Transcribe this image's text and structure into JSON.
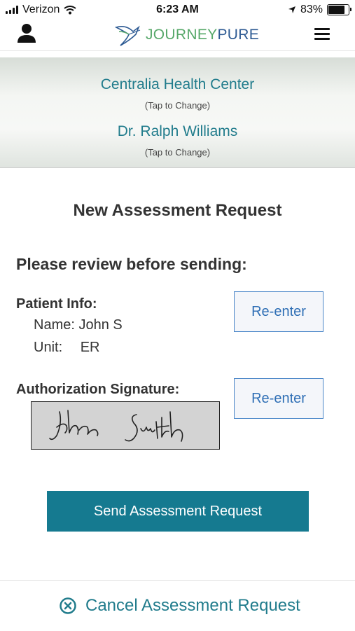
{
  "status_bar": {
    "carrier": "Verizon",
    "time": "6:23 AM",
    "battery_percent": "83%",
    "battery_level": 0.83
  },
  "header": {
    "logo_part1": "JOURNEY",
    "logo_part2": "PURE",
    "icons": [
      "user-icon",
      "logo-bird-icon",
      "menu-icon"
    ]
  },
  "provider": {
    "facility": "Centralia Health Center",
    "facility_hint": "(Tap to Change)",
    "doctor": "Dr. Ralph Williams",
    "doctor_hint": "(Tap to Change)"
  },
  "review": {
    "title": "New Assessment Request",
    "heading": "Please review before sending:",
    "patient_label": "Patient Info:",
    "name_label": "Name:",
    "name_value": "John S",
    "unit_label": "Unit:",
    "unit_value": "ER",
    "reenter_patient": "Re-enter",
    "auth_label": "Authorization Signature:",
    "reenter_signature": "Re-enter"
  },
  "actions": {
    "send": "Send Assessment Request",
    "cancel": "Cancel Assessment Request"
  },
  "colors": {
    "teal": "#217c8c",
    "send_button": "#157a90",
    "reenter_border": "#4a86c8",
    "logo_green": "#57a86a",
    "logo_blue": "#2d5a93"
  }
}
